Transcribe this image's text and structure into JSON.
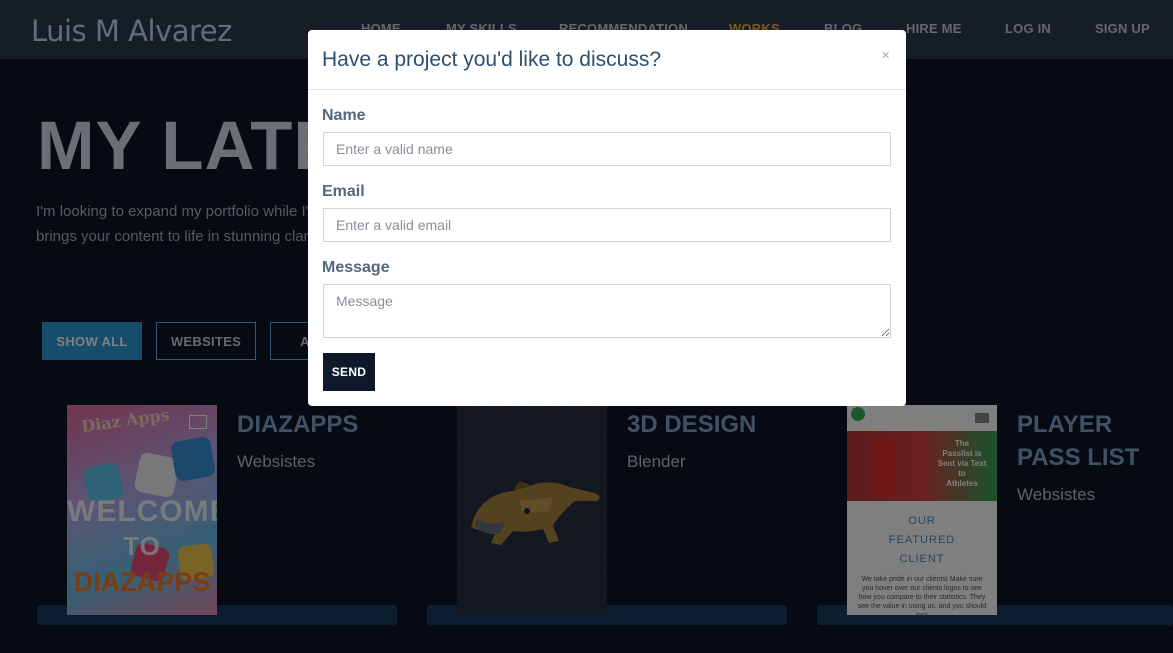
{
  "brand": {
    "name": "Luis M Alvarez"
  },
  "nav": {
    "items": [
      {
        "label": "HOME"
      },
      {
        "label": "MY SKILLS"
      },
      {
        "label": "RECOMMENDATION"
      },
      {
        "label": "WORKS"
      },
      {
        "label": "BLOG"
      },
      {
        "label": "HIRE ME"
      },
      {
        "label": "LOG IN"
      },
      {
        "label": "SIGN UP"
      }
    ],
    "active": "WORKS"
  },
  "hero": {
    "title": "MY LATE",
    "text_line1": "I'm looking to expand my portfolio while I'",
    "text_line2": "brings your content to life in stunning clari"
  },
  "filters": {
    "items": [
      {
        "label": "SHOW ALL"
      },
      {
        "label": "WEBSITES"
      },
      {
        "label": "A"
      }
    ]
  },
  "works": [
    {
      "title": "DIAZAPPS",
      "subtitle": "Websistes",
      "thumb_logo": "Diaz Apps",
      "thumb_text": [
        "WELCOME",
        "TO",
        "DIAZAPPS"
      ]
    },
    {
      "title": "3D DESIGN",
      "subtitle": "Blender"
    },
    {
      "title_line1": "PLAYER",
      "title_line2": "PASS LIST",
      "subtitle": "Websistes",
      "thumb_banner": [
        "The",
        "Passlist is",
        "Sent via Text",
        "to",
        "Athletes"
      ],
      "thumb_heading": [
        "OUR",
        "FEATURED",
        "CLIENT"
      ],
      "thumb_body": "We take pride in our clients! Make sure you hover over our clients logos to see how you compare to their statistics. They see the value in using us, and you should too!"
    }
  ],
  "modal": {
    "title": "Have a project you'd like to discuss?",
    "close": "×",
    "fields": {
      "name": {
        "label": "Name",
        "placeholder": "Enter a valid name"
      },
      "email": {
        "label": "Email",
        "placeholder": "Enter a valid email"
      },
      "message": {
        "label": "Message",
        "placeholder": "Message"
      }
    },
    "send_label": "SEND"
  },
  "colors": {
    "accent": "#f0b54a",
    "primary_button": "#2d9ad8",
    "send_button": "#0e1a2a",
    "modal_title": "#2e4f6e"
  }
}
